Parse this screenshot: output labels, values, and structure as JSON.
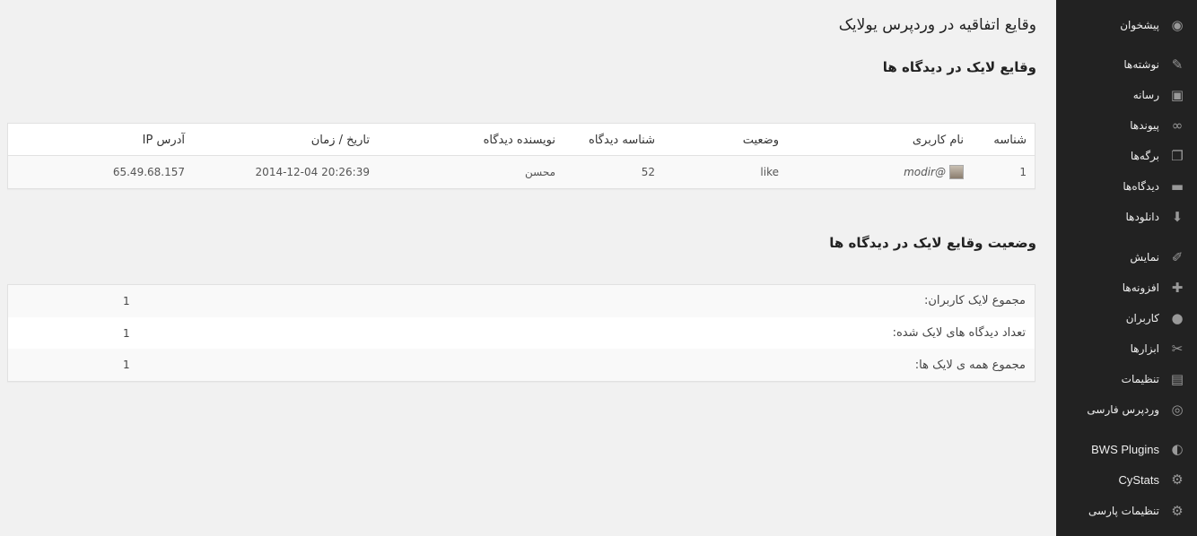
{
  "menu": [
    {
      "label": "پیشخوان",
      "icon": "dashboard-icon",
      "glyph": "◉"
    },
    {
      "label": "نوشته‌ها",
      "icon": "pin-icon",
      "glyph": "✎"
    },
    {
      "label": "رسانه",
      "icon": "media-icon",
      "glyph": "▣"
    },
    {
      "label": "پیوندها",
      "icon": "link-icon",
      "glyph": "∞"
    },
    {
      "label": "برگه‌ها",
      "icon": "pages-icon",
      "glyph": "❐"
    },
    {
      "label": "دیدگاه‌ها",
      "icon": "comments-icon",
      "glyph": "▬"
    },
    {
      "label": "دانلودها",
      "icon": "download-icon",
      "glyph": "⬇"
    },
    {
      "label": "نمایش",
      "icon": "appearance-icon",
      "glyph": "✐"
    },
    {
      "label": "افزونه‌ها",
      "icon": "plugins-icon",
      "glyph": "✚"
    },
    {
      "label": "کاربران",
      "icon": "users-icon",
      "glyph": "●"
    },
    {
      "label": "ابزارها",
      "icon": "tools-icon",
      "glyph": "✂"
    },
    {
      "label": "تنظیمات",
      "icon": "settings-icon",
      "glyph": "▤"
    },
    {
      "label": "وردپرس فارسی",
      "icon": "wordpress-icon",
      "glyph": "◎"
    },
    {
      "label": "BWS Plugins",
      "icon": "bws-icon",
      "glyph": "◐"
    },
    {
      "label": "CyStats",
      "icon": "gear-icon",
      "glyph": "⚙"
    },
    {
      "label": "تنظیمات پارسی",
      "icon": "gear-icon",
      "glyph": "⚙"
    }
  ],
  "page": {
    "title": "وقایع اتفاقیه در وردپرس یولایک",
    "section1_title": "وقایع لایک در دیدگاه ها",
    "section2_title": "وضعیت وقایع لایک در دیدگاه ها"
  },
  "likes_table": {
    "headers": {
      "id": "شناسه",
      "username": "نام کاربری",
      "status": "وضعیت",
      "comment_id": "شناسه دیدگاه",
      "comment_author": "نویسنده دیدگاه",
      "datetime": "تاریخ / زمان",
      "ip": "آدرس IP"
    },
    "rows": [
      {
        "id": "1",
        "username": "modir@",
        "status": "like",
        "comment_id": "52",
        "comment_author": "محسن",
        "datetime": "2014-12-04 20:26:39",
        "ip": "65.49.68.157"
      }
    ]
  },
  "stats": [
    {
      "label": "مجموع لایک کاربران:",
      "value": "1"
    },
    {
      "label": "تعداد دیدگاه های لایک شده:",
      "value": "1"
    },
    {
      "label": "مجموع همه ی لایک ها:",
      "value": "1"
    }
  ]
}
